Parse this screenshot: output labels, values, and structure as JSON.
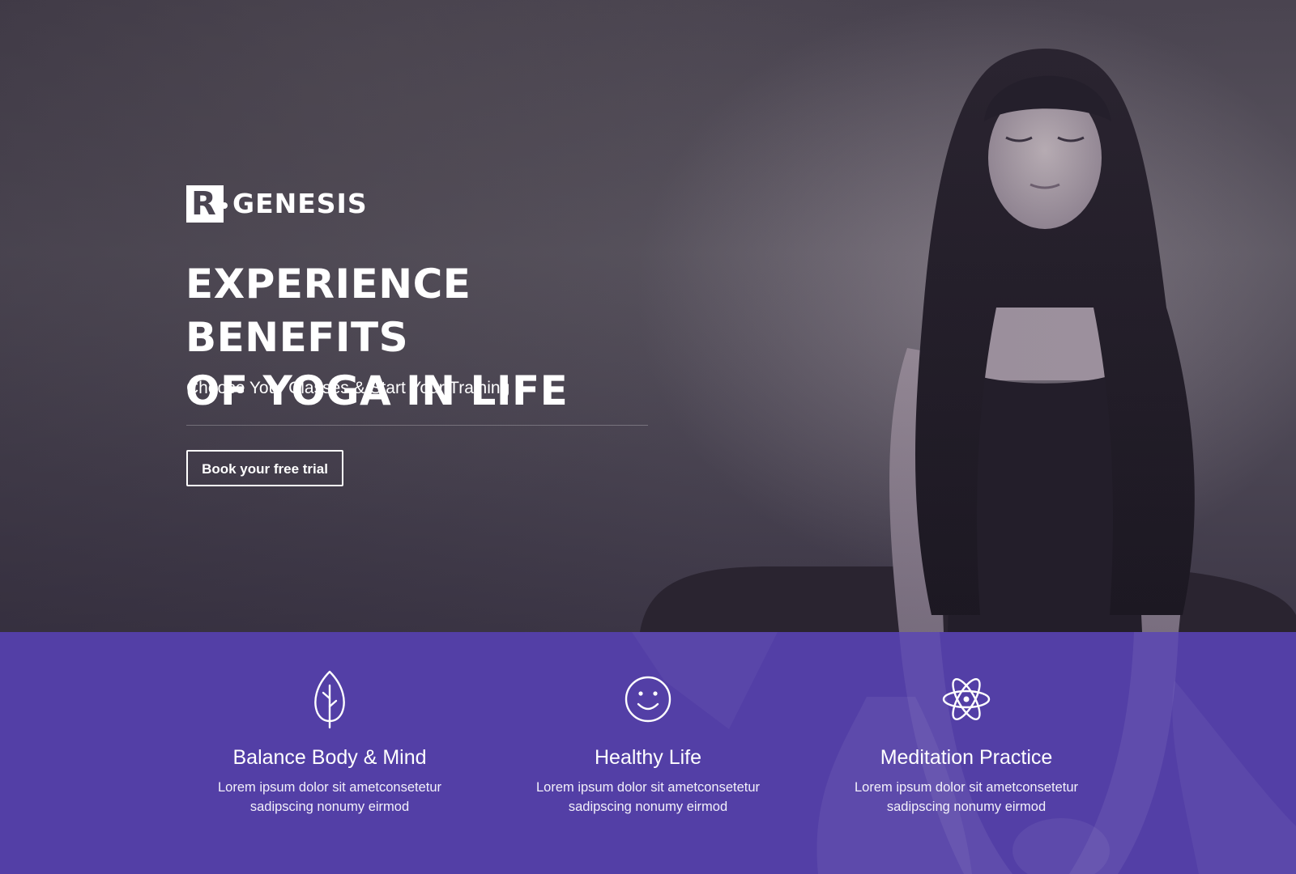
{
  "brand": {
    "mark_letter": "R",
    "name": "GENESIS"
  },
  "hero": {
    "headline_line1": "EXPERIENCE BENEFITS",
    "headline_line2": "OF YOGA IN LIFE",
    "subheadline": "Choose Your Classes & Start Your Training",
    "cta_label": "Book your free trial"
  },
  "features": [
    {
      "icon": "leaf-icon",
      "title": "Balance Body & Mind",
      "desc_line1": "Lorem ipsum dolor sit ametconsetetur",
      "desc_line2": "sadipscing nonumy eirmod"
    },
    {
      "icon": "smiley-face-icon",
      "title": "Healthy Life",
      "desc_line1": "Lorem ipsum dolor sit ametconsetetur",
      "desc_line2": "sadipscing nonumy eirmod"
    },
    {
      "icon": "atom-icon",
      "title": "Meditation Practice",
      "desc_line1": "Lorem ipsum dolor sit ametconsetetur",
      "desc_line2": "sadipscing nonumy eirmod"
    }
  ],
  "colors": {
    "feature_band": "#533fa6",
    "hero_overlay": "#4b4552",
    "text": "#ffffff"
  }
}
